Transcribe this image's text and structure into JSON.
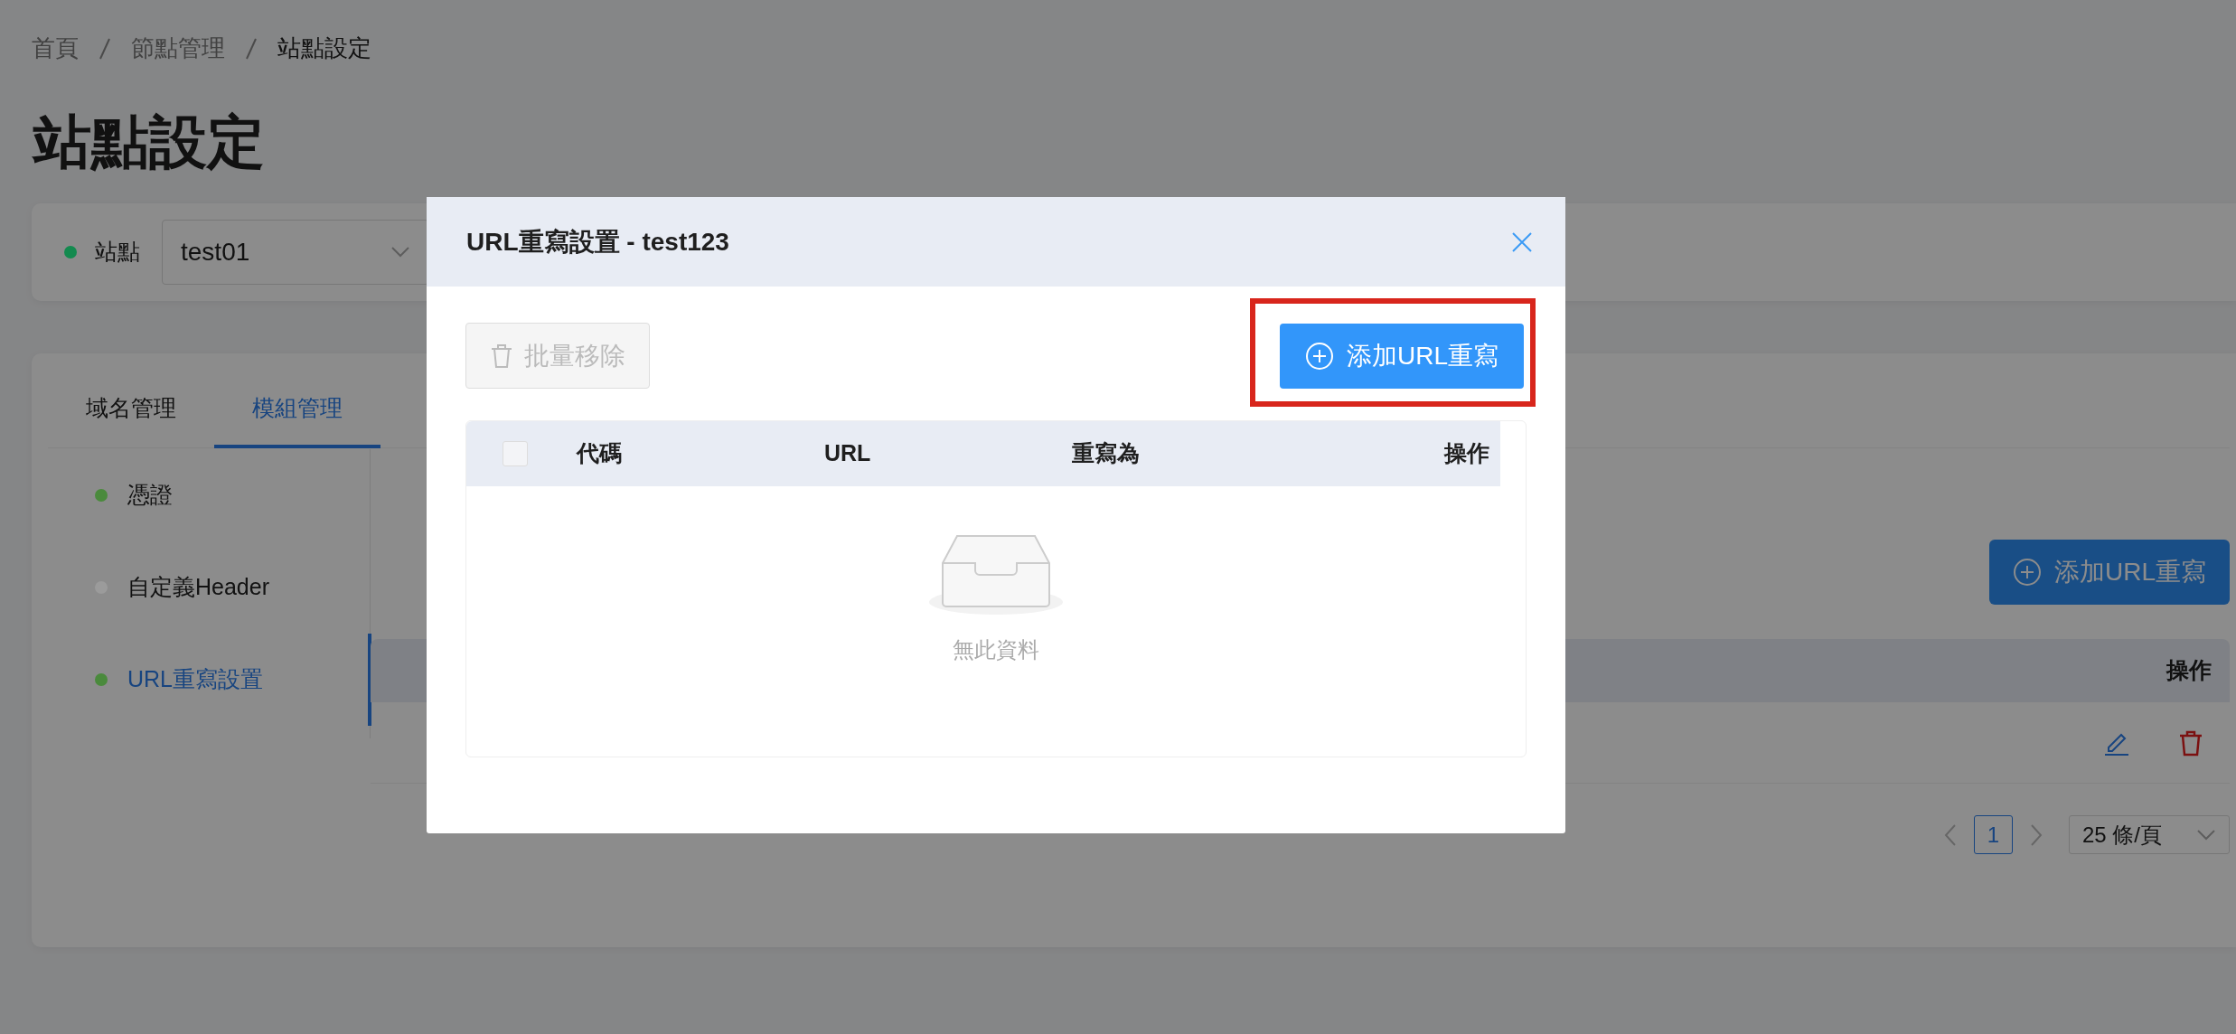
{
  "breadcrumb": [
    {
      "label": "首頁",
      "current": false
    },
    {
      "label": "節點管理",
      "current": false
    },
    {
      "label": "站點設定",
      "current": true
    }
  ],
  "page_title": "站點設定",
  "site_filter": {
    "label": "站點",
    "color": "#138a4f",
    "value": "test01"
  },
  "tabs": [
    {
      "label": "域名管理",
      "selected": false
    },
    {
      "label": "模組管理",
      "selected": true
    }
  ],
  "modules": [
    {
      "label": "憑證",
      "color": "#4a8a3c",
      "selected": false
    },
    {
      "label": "自定義Header",
      "color": "#9b9b9b",
      "selected": false
    },
    {
      "label": "URL重寫設置",
      "color": "#4a8a3c",
      "selected": true
    }
  ],
  "panel": {
    "add_button": "添加URL重寫",
    "table": {
      "columns": [
        "操作"
      ]
    },
    "pagination": {
      "current_page": "1",
      "page_size": "25 條/頁"
    }
  },
  "modal": {
    "title": "URL重寫設置 - test123",
    "remove_button": {
      "label": "批量移除",
      "disabled": true
    },
    "add_button": {
      "label": "添加URL重寫",
      "highlighted": true
    },
    "table": {
      "select_all": {
        "checked": false
      },
      "columns": [
        "代碼",
        "URL",
        "重寫為",
        "操作"
      ]
    },
    "empty_text": "無此資料"
  }
}
